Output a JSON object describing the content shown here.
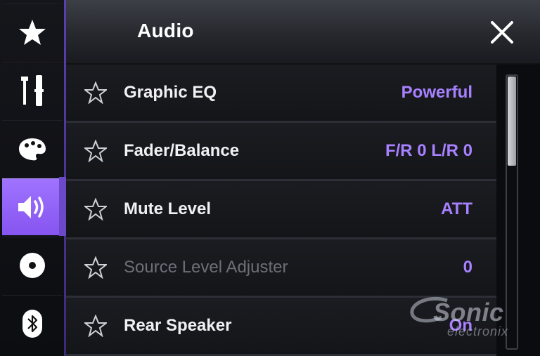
{
  "header": {
    "title": "Audio",
    "close_icon": "close-icon"
  },
  "sidebar": {
    "items": [
      {
        "name": "favorites",
        "icon": "star-icon",
        "active": false
      },
      {
        "name": "system",
        "icon": "tools-icon",
        "active": false
      },
      {
        "name": "theme",
        "icon": "palette-icon",
        "active": false
      },
      {
        "name": "audio",
        "icon": "speaker-icon",
        "active": true
      },
      {
        "name": "video",
        "icon": "disc-icon",
        "active": false
      },
      {
        "name": "bluetooth",
        "icon": "bluetooth-icon",
        "active": false
      }
    ]
  },
  "settings": [
    {
      "label": "Graphic EQ",
      "value": "Powerful",
      "enabled": true
    },
    {
      "label": "Fader/Balance",
      "value": "F/R 0 L/R 0",
      "enabled": true
    },
    {
      "label": "Mute Level",
      "value": "ATT",
      "enabled": true
    },
    {
      "label": "Source Level Adjuster",
      "value": "0",
      "enabled": false
    },
    {
      "label": "Rear Speaker",
      "value": "On",
      "enabled": true
    }
  ],
  "scrollbar": {
    "position_fraction": 0.0,
    "visible_fraction": 0.33
  },
  "watermark": {
    "main": "Sonic",
    "sub": "electronix"
  },
  "colors": {
    "accent": "#9f74ff",
    "value_text": "#a781ff",
    "active_tab": "#8654f0"
  }
}
